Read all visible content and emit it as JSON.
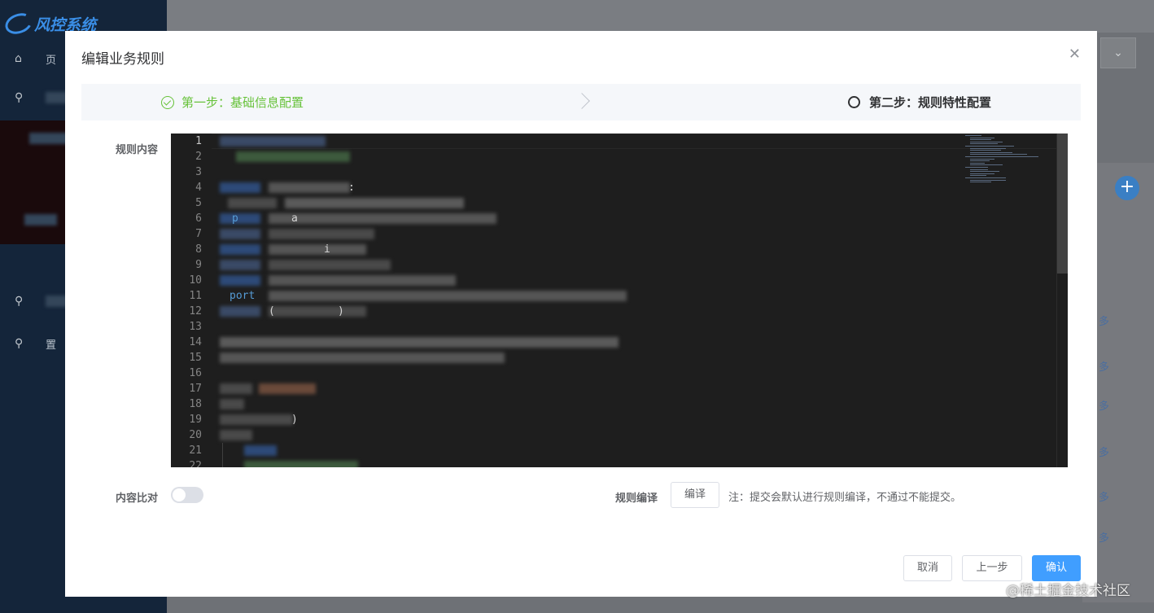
{
  "app": {
    "logo_text": "风控系统",
    "nav_items": [
      {
        "icon": "home-icon",
        "label": "页"
      },
      {
        "icon": "search-icon",
        "label": ""
      },
      {
        "icon": "list-icon",
        "label": ""
      },
      {
        "icon": "grid-icon",
        "label": ""
      },
      {
        "icon": "search-icon",
        "label": ""
      },
      {
        "icon": "search-icon",
        "label": "置"
      }
    ],
    "select_chevron": "⌄",
    "add_button": "+",
    "row_links": [
      "多",
      "多",
      "多",
      "多",
      "多",
      "多"
    ]
  },
  "dialog": {
    "title": "编辑业务规则",
    "close_icon": "close-icon",
    "steps": [
      {
        "label": "第一步：基础信息配置",
        "status": "done",
        "color": "#67c23a"
      },
      {
        "label": "第二步：规则特性配置",
        "status": "current",
        "color": "#303133"
      }
    ],
    "content_label": "规则内容",
    "editor": {
      "line_numbers": [
        "1",
        "2",
        "3",
        "4",
        "5",
        "6",
        "7",
        "8",
        "9",
        "10",
        "11",
        "12",
        "13",
        "14",
        "15",
        "16",
        "17",
        "18",
        "19",
        "20",
        "21",
        "22"
      ],
      "visible_fragments": [
        {
          "line": 4,
          "text": ":"
        },
        {
          "line": 6,
          "text": "p"
        },
        {
          "line": 6,
          "text": "a"
        },
        {
          "line": 8,
          "text": "i"
        },
        {
          "line": 11,
          "text": "port"
        },
        {
          "line": 12,
          "text": "("
        },
        {
          "line": 12,
          "text": ")"
        },
        {
          "line": 19,
          "text": ")"
        }
      ]
    },
    "compare_label": "内容比对",
    "compare_enabled": false,
    "compile_label": "规则编译",
    "compile_button": "编译",
    "compile_note": "注：提交会默认进行规则编译，不通过不能提交。",
    "buttons": {
      "cancel": "取消",
      "prev": "上一步",
      "confirm": "确认"
    }
  },
  "watermark": "@稀土掘金技术社区",
  "colors": {
    "primary": "#409eff",
    "success": "#67c23a",
    "editor_bg": "#1e1e1e",
    "sidebar_bg": "#14253a"
  }
}
